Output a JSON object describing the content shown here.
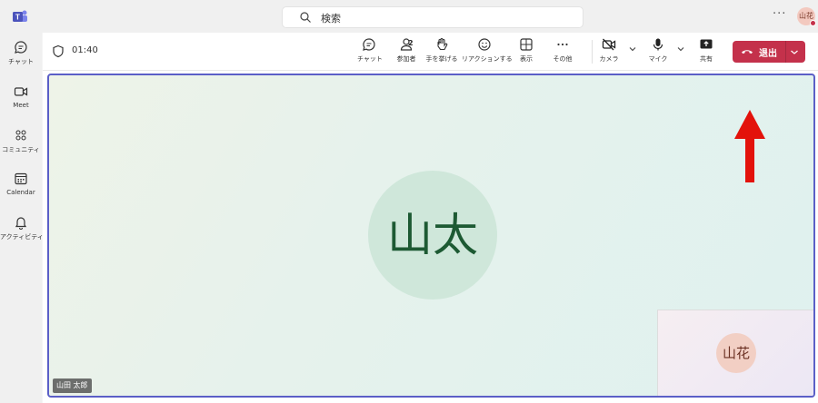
{
  "search": {
    "placeholder": "検索"
  },
  "top": {
    "avatar_initials": "山花"
  },
  "nav": [
    {
      "label": "チャット"
    },
    {
      "label": "Meet"
    },
    {
      "label": "コミュニティ"
    },
    {
      "label": "Calendar"
    },
    {
      "label": "アクティビティ"
    }
  ],
  "meeting": {
    "timer": "01:40",
    "participant_count": "2",
    "buttons": {
      "chat": "チャット",
      "people": "参加者",
      "raise": "手を挙げる",
      "react": "リアクションする",
      "view": "表示",
      "more": "その他",
      "camera": "カメラ",
      "mic": "マイク",
      "share": "共有",
      "leave": "退出"
    },
    "main_participant": {
      "initials": "山太",
      "name": "山田 太郎"
    },
    "self": {
      "initials": "山花"
    }
  },
  "colors": {
    "accent": "#5b5fc7",
    "leave": "#c4314b",
    "annotation_arrow": "#e3120b"
  }
}
